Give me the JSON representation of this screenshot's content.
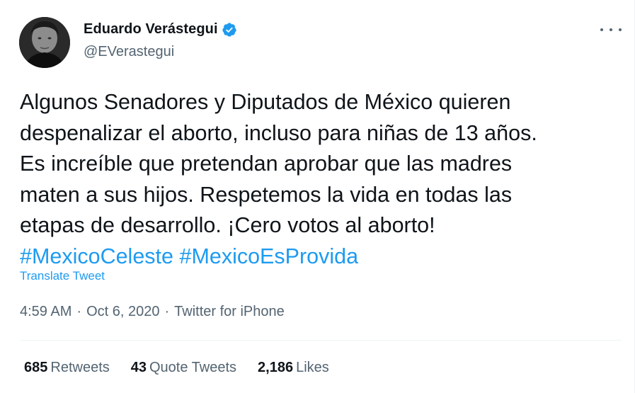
{
  "author": {
    "name": "Eduardo Verástegui",
    "handle": "@EVerastegui",
    "verified": true
  },
  "tweet": {
    "lines": [
      "Algunos Senadores y Diputados de México quieren",
      "despenalizar el aborto, incluso para niñas de 13 años.",
      "Es increíble que pretendan aprobar que las madres",
      "maten a sus hijos. Respetemos la vida en todas las",
      "etapas de desarrollo. ¡Cero votos al aborto!"
    ],
    "hashtags": [
      "#MexicoCeleste",
      "#MexicoEsProvida"
    ]
  },
  "translate_label": "Translate Tweet",
  "meta": {
    "time": "4:59 AM",
    "separator": "·",
    "date": "Oct 6, 2020",
    "source": "Twitter for iPhone"
  },
  "stats": {
    "retweets_count": "685",
    "retweets_label": "Retweets",
    "quotes_count": "43",
    "quotes_label": "Quote Tweets",
    "likes_count": "2,186",
    "likes_label": "Likes"
  },
  "colors": {
    "link": "#1d9bf0",
    "text": "#0f1419",
    "secondary": "#536471",
    "divider": "#eff3f4"
  }
}
